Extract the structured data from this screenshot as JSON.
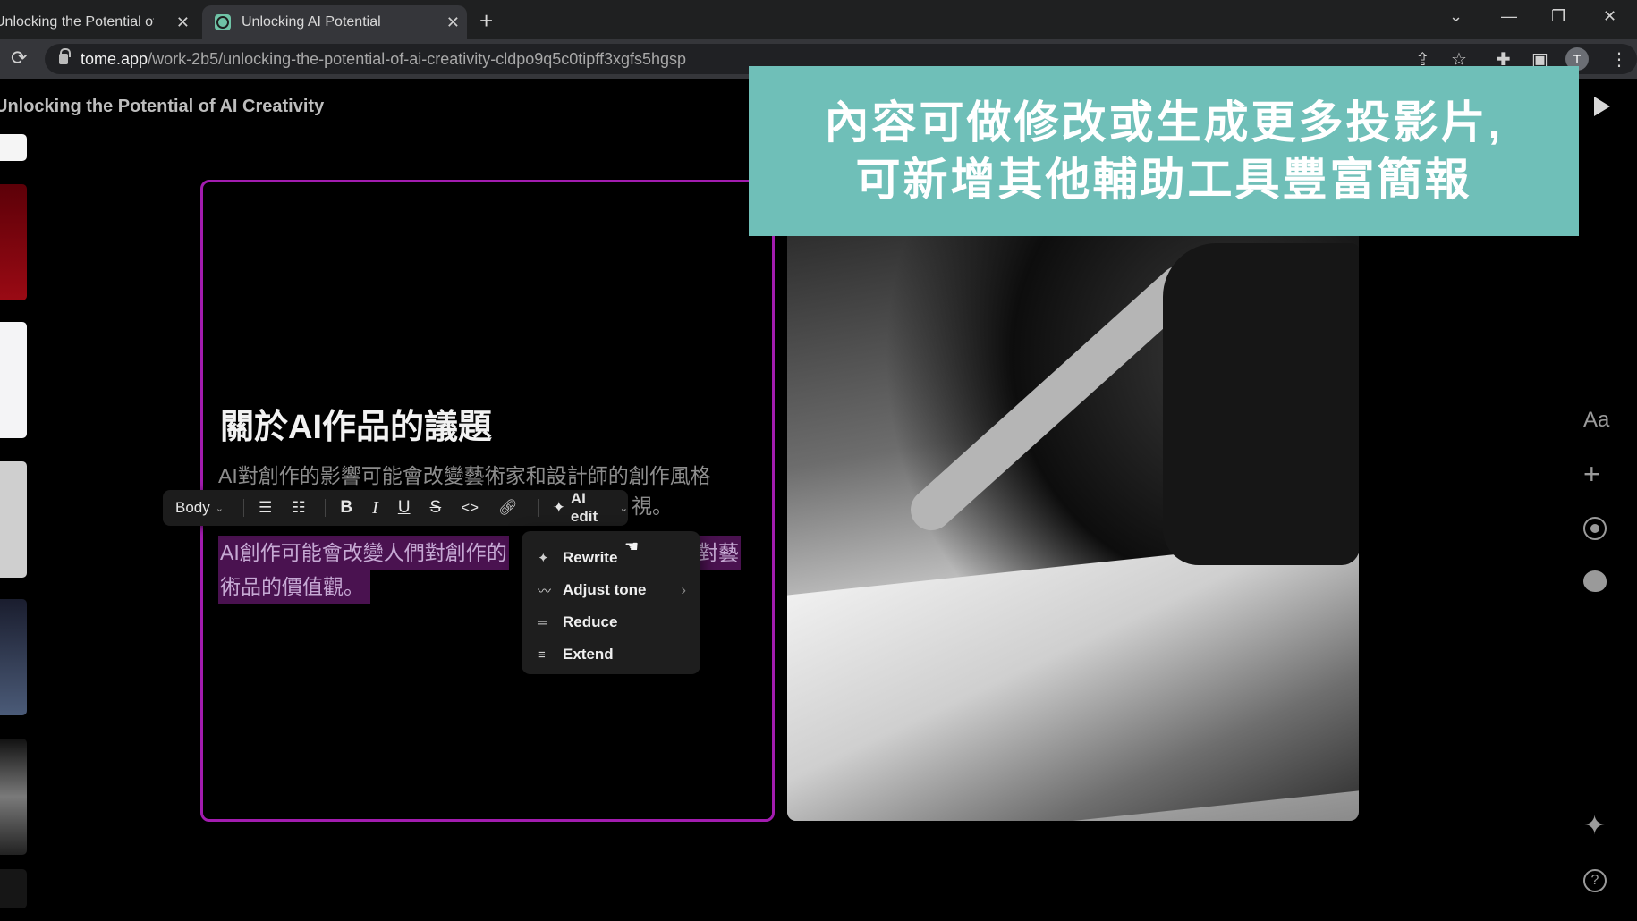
{
  "browser": {
    "tabs": [
      {
        "title": "Unlocking the Potential of AI C"
      },
      {
        "title": "Unlocking AI Potential"
      }
    ],
    "close_glyph": "✕",
    "new_tab_glyph": "+",
    "url_domain": "tome.app",
    "url_path": "/work-2b5/unlocking-the-potential-of-ai-creativity-cldpo9q5c0tipff3xgfs5hgsp",
    "avatar_letter": "T"
  },
  "app": {
    "doc_title": "Unlocking the Potential of AI Creativity"
  },
  "slide": {
    "heading": "關於AI作品的議題",
    "paragraph1_line1": "AI對創作的影響可能會改變藝術家和設計師的創作風格",
    "paragraph1_line2_tail": "視。",
    "paragraph2_line1_start": "AI創作可能會改變人們對創作的",
    "paragraph2_line1_end": "對藝",
    "paragraph2_line2": "術品的價值觀。"
  },
  "format_toolbar": {
    "style_label": "Body",
    "bold": "B",
    "italic": "I",
    "underline": "U",
    "strike": "S",
    "code": "<>",
    "ai_edit_label": "AI edit"
  },
  "ai_menu": {
    "items": [
      {
        "label": "Rewrite",
        "icon": "sparkle-icon"
      },
      {
        "label": "Adjust tone",
        "icon": "wave-icon"
      },
      {
        "label": "Reduce",
        "icon": "reduce-icon"
      },
      {
        "label": "Extend",
        "icon": "extend-icon"
      }
    ]
  },
  "banner": {
    "line1": "內容可做修改或生成更多投影片,",
    "line2": "可新增其他輔助工具豐富簡報"
  },
  "right_rail": {
    "text_style_label": "Aa",
    "help_label": "?"
  },
  "colors": {
    "slide_border": "#a21caf",
    "banner_bg": "#6fbfb8",
    "highlight": "#4a1250"
  }
}
